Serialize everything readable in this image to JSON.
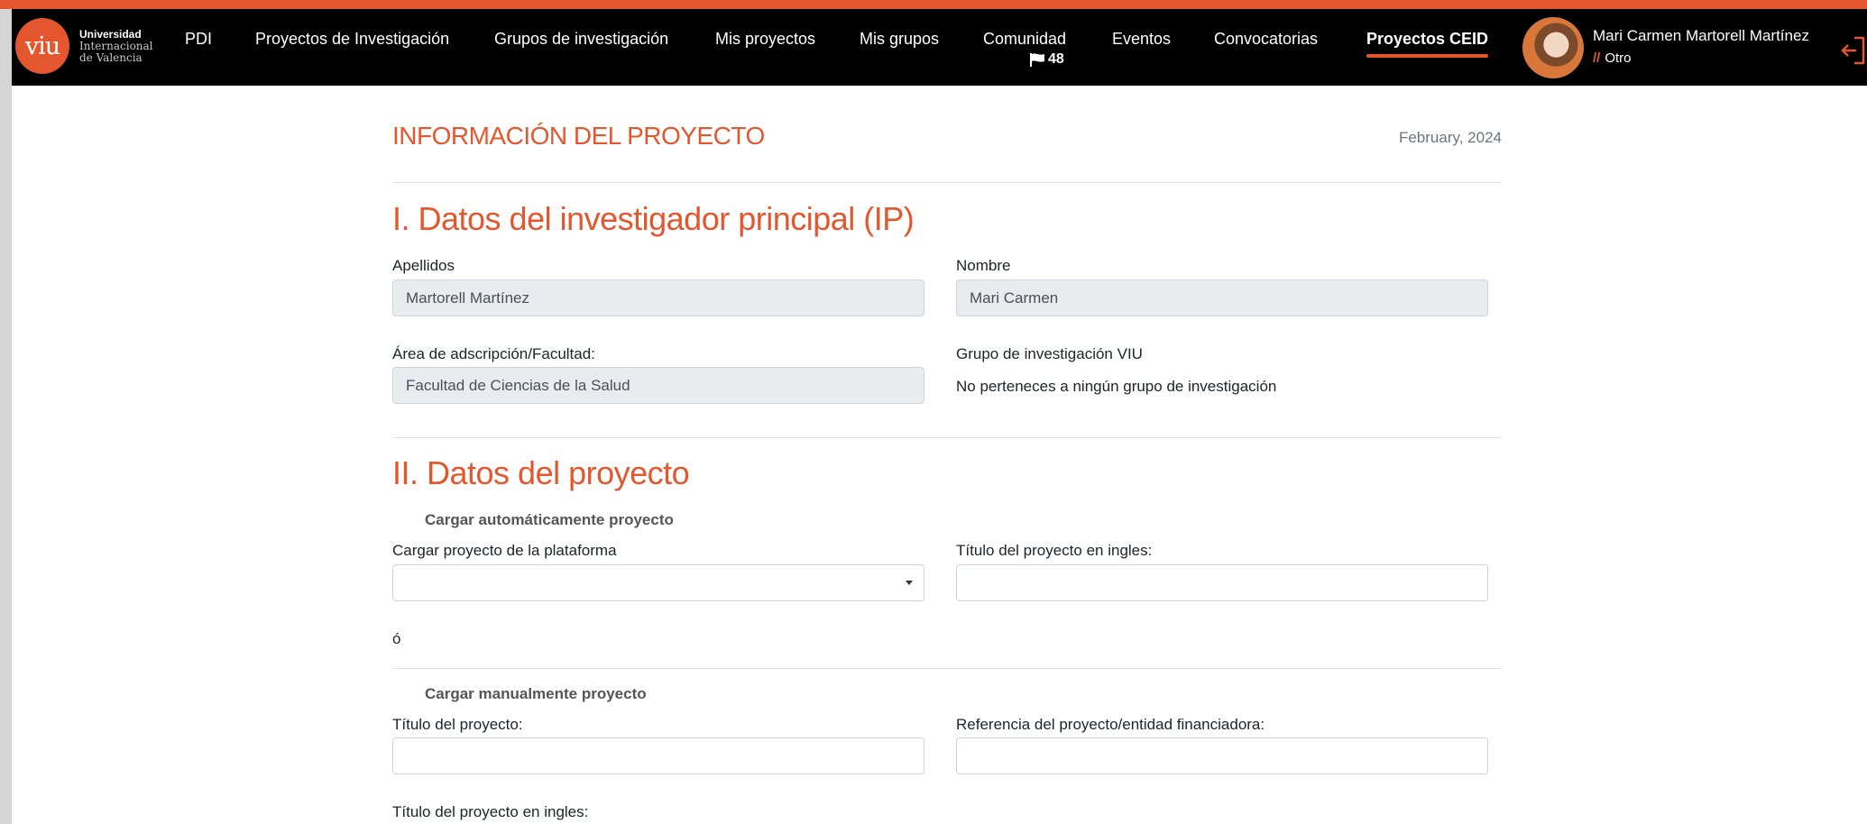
{
  "header": {
    "logo": {
      "mark": "viu",
      "line1": "Universidad",
      "line2": "Internacional",
      "line3": "de Valencia"
    },
    "nav": [
      {
        "label": "PDI"
      },
      {
        "label": "Proyectos de Investigación"
      },
      {
        "label": "Grupos de investigación"
      },
      {
        "label": "Mis proyectos"
      },
      {
        "label": "Mis grupos"
      },
      {
        "label": "Comunidad"
      },
      {
        "label": "Eventos"
      },
      {
        "label": "Convocatorias"
      },
      {
        "label": "Proyectos CEID"
      }
    ],
    "active_nav": "Proyectos CEID",
    "community_badge": {
      "icon": "flag-icon",
      "count": "48"
    },
    "user": {
      "name": "Mari Carmen Martorell Martínez",
      "role_prefix": "//",
      "role": "Otro"
    },
    "logout_icon": "logout-icon"
  },
  "main": {
    "title": "INFORMACIÓN DEL PROYECTO",
    "date": "February, 2024",
    "section1": {
      "title": "I. Datos del investigador principal (IP)",
      "apellidos_label": "Apellidos",
      "apellidos_value": "Martorell Martínez",
      "nombre_label": "Nombre",
      "nombre_value": "Mari Carmen",
      "area_label": "Área de adscripción/Facultad:",
      "area_value": "Facultad de Ciencias de la Salud",
      "grupo_label": "Grupo de investigación VIU",
      "grupo_value": "No perteneces a ningún grupo de investigación"
    },
    "section2": {
      "title": "II. Datos del proyecto",
      "auto_heading": "Cargar automáticamente proyecto",
      "platform_label": "Cargar proyecto de la plataforma",
      "platform_value": "",
      "title_en_label": "Título del proyecto en ingles:",
      "title_en_value": "",
      "or_text": "ó",
      "manual_heading": "Cargar manualmente proyecto",
      "title_label": "Título del proyecto:",
      "title_value": "",
      "reference_label": "Referencia del proyecto/entidad financiadora:",
      "reference_value": "",
      "title_en2_label": "Título del proyecto en ingles:"
    }
  },
  "colors": {
    "accent": "#e4572e",
    "navbar": "#000000",
    "readonly_bg": "#e9ecef"
  }
}
